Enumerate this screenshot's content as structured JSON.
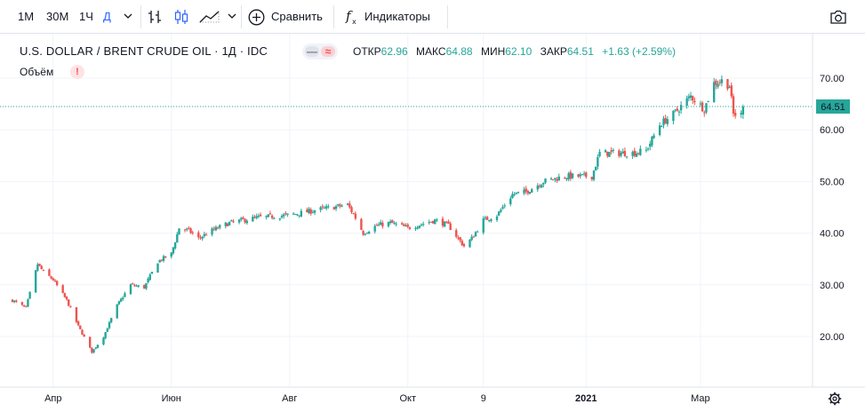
{
  "toolbar": {
    "intervals": [
      "1М",
      "30М",
      "1Ч",
      "Д"
    ],
    "active_interval": "Д",
    "compare_label": "Сравнить",
    "indicators_label": "Индикаторы",
    "icons": [
      "chevron-down-icon",
      "bar-style-icon",
      "candle-style-icon",
      "area-style-icon",
      "plus-circle-icon",
      "fx-icon",
      "camera-icon"
    ]
  },
  "legend": {
    "title": "U.S. DOLLAR / BRENT CRUDE OIL · 1Д · IDC",
    "pill_a": "—",
    "pill_b": "≈",
    "open_label": "ОТКР",
    "open_value": "62.96",
    "high_label": "МАКС",
    "high_value": "64.88",
    "low_label": "МИН",
    "low_value": "62.10",
    "close_label": "ЗАКР",
    "close_value": "64.51",
    "change": "+1.63 (+2.59%)",
    "volume_label": "Объём",
    "volume_badge": "!"
  },
  "chart_data": {
    "type": "candlestick",
    "ylim": [
      10,
      75
    ],
    "y_ticks": [
      20,
      30,
      40,
      50,
      60,
      70
    ],
    "y_tick_labels": [
      "20.00",
      "30.00",
      "40.00",
      "50.00",
      "60.00",
      "70.00"
    ],
    "x_tick_labels": [
      "Апр",
      "Июн",
      "Авг",
      "Окт",
      "9",
      "2021",
      "Мар"
    ],
    "x_tick_dates": [
      "2020-04-01",
      "2020-06-01",
      "2020-08-01",
      "2020-10-01",
      "2020-11-09",
      "2021-01-01",
      "2021-03-01"
    ],
    "x_range": [
      "2020-03-11",
      "2021-04-26"
    ],
    "last_price": 64.51,
    "last_price_label": "64.51",
    "colors": {
      "up": "#26a69a",
      "down": "#ef5350",
      "last_line": "#26a69a",
      "grid": "#f0f3fa"
    },
    "closes": [
      {
        "d": "2020-03-11",
        "c": 27.0
      },
      {
        "d": "2020-03-18",
        "c": 25.5
      },
      {
        "d": "2020-03-24",
        "c": 34.0
      },
      {
        "d": "2020-03-27",
        "c": 32.5
      },
      {
        "d": "2020-04-01",
        "c": 31.0
      },
      {
        "d": "2020-04-08",
        "c": 27.0
      },
      {
        "d": "2020-04-14",
        "c": 22.0
      },
      {
        "d": "2020-04-21",
        "c": 17.0
      },
      {
        "d": "2020-04-27",
        "c": 20.0
      },
      {
        "d": "2020-05-04",
        "c": 26.0
      },
      {
        "d": "2020-05-11",
        "c": 30.0
      },
      {
        "d": "2020-05-18",
        "c": 29.5
      },
      {
        "d": "2020-05-25",
        "c": 34.5
      },
      {
        "d": "2020-06-01",
        "c": 36.0
      },
      {
        "d": "2020-06-05",
        "c": 41.0
      },
      {
        "d": "2020-06-10",
        "c": 40.5
      },
      {
        "d": "2020-06-15",
        "c": 39.0
      },
      {
        "d": "2020-06-22",
        "c": 40.5
      },
      {
        "d": "2020-07-01",
        "c": 42.0
      },
      {
        "d": "2020-07-15",
        "c": 43.0
      },
      {
        "d": "2020-08-01",
        "c": 43.5
      },
      {
        "d": "2020-08-15",
        "c": 44.5
      },
      {
        "d": "2020-08-31",
        "c": 45.5
      },
      {
        "d": "2020-09-04",
        "c": 43.0
      },
      {
        "d": "2020-09-08",
        "c": 40.0
      },
      {
        "d": "2020-09-15",
        "c": 41.5
      },
      {
        "d": "2020-09-22",
        "c": 42.0
      },
      {
        "d": "2020-10-01",
        "c": 41.0
      },
      {
        "d": "2020-10-15",
        "c": 42.5
      },
      {
        "d": "2020-10-22",
        "c": 41.5
      },
      {
        "d": "2020-10-30",
        "c": 37.5
      },
      {
        "d": "2020-11-03",
        "c": 39.0
      },
      {
        "d": "2020-11-09",
        "c": 42.5
      },
      {
        "d": "2020-11-16",
        "c": 43.5
      },
      {
        "d": "2020-11-24",
        "c": 47.5
      },
      {
        "d": "2020-12-01",
        "c": 48.0
      },
      {
        "d": "2020-12-10",
        "c": 50.0
      },
      {
        "d": "2020-12-21",
        "c": 51.0
      },
      {
        "d": "2021-01-04",
        "c": 51.0
      },
      {
        "d": "2021-01-08",
        "c": 55.5
      },
      {
        "d": "2021-01-15",
        "c": 55.5
      },
      {
        "d": "2021-01-25",
        "c": 55.5
      },
      {
        "d": "2021-02-01",
        "c": 56.0
      },
      {
        "d": "2021-02-08",
        "c": 61.0
      },
      {
        "d": "2021-02-15",
        "c": 63.0
      },
      {
        "d": "2021-02-24",
        "c": 66.5
      },
      {
        "d": "2021-03-03",
        "c": 64.0
      },
      {
        "d": "2021-03-08",
        "c": 69.0
      },
      {
        "d": "2021-03-12",
        "c": 69.5
      },
      {
        "d": "2021-03-16",
        "c": 68.5
      },
      {
        "d": "2021-03-18",
        "c": 63.0
      },
      {
        "d": "2021-03-22",
        "c": 62.9
      },
      {
        "d": "2021-03-23",
        "c": 64.51
      }
    ]
  }
}
